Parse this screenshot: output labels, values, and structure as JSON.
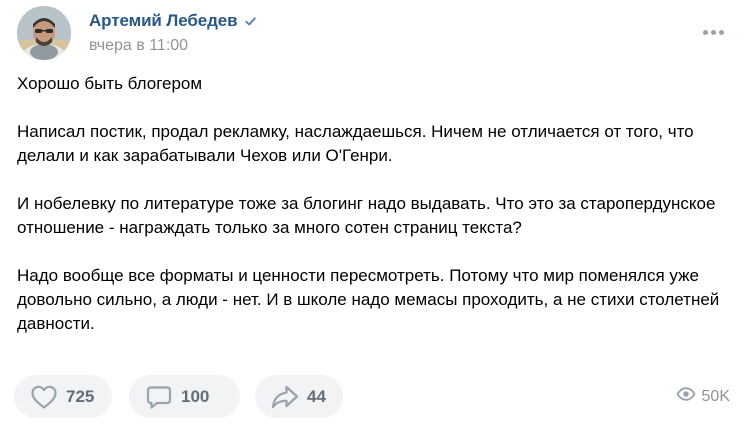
{
  "post": {
    "author": {
      "name": "Артемий Лебедев",
      "verified": true
    },
    "date": "вчера в 11:00",
    "paragraphs": [
      "Хорошо быть блогером",
      "Написал постик, продал рекламку, наслаждаешься. Ничем не отличается от того, что делали и как зарабатывали Чехов или О'Генри.",
      "И нобелевку по литературе тоже за блогинг надо выдавать. Что это за староперду­нское отношение - награждать только за много сотен страниц текста?",
      "Надо вообще все форматы и ценности пересмотреть. Потому что мир поменялся уже довольно сильно, а люди - нет. И в школе надо мемасы проходить, а не стихи столетней давности."
    ],
    "actions": {
      "likes": "725",
      "comments": "100",
      "shares": "44"
    },
    "views": "50K"
  },
  "colors": {
    "link": "#2a5885",
    "muted": "#939393",
    "button_bg": "#f2f3f5",
    "icon": "#99a2ad",
    "verified": "#5181b8"
  },
  "icons": {
    "verified": "check-badge-icon",
    "more": "more-horizontal-icon",
    "like": "heart-outline-icon",
    "comment": "comment-bubble-icon",
    "share": "share-arrow-icon",
    "views": "eye-icon"
  }
}
